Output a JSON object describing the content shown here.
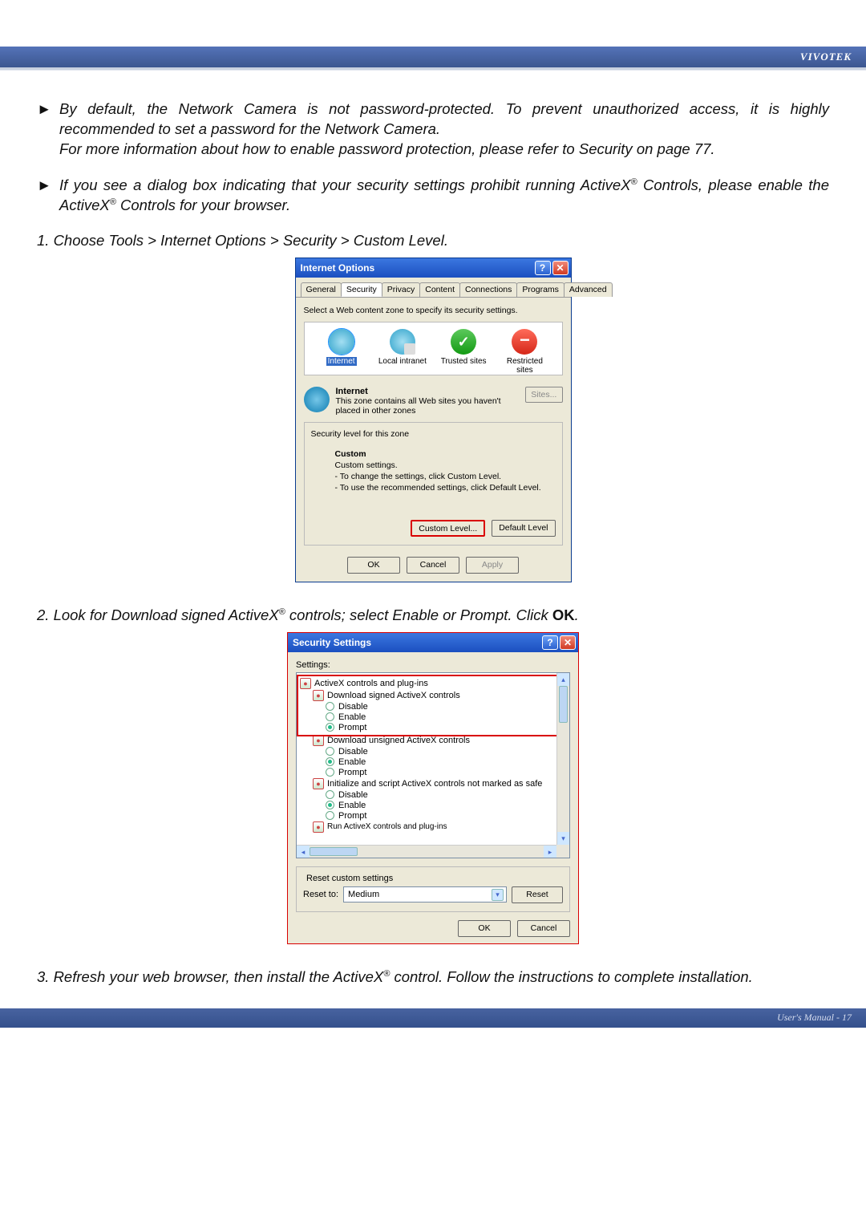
{
  "brand": "VIVOTEK",
  "bullets": {
    "b1_a": "By default, the Network Camera is not password-protected. To prevent unauthorized access, it is highly recommended to set a password for the Network Camera.",
    "b1_b": "For more information about how to enable password protection, please refer to Security on page 77.",
    "b2_a": "If you see a dialog box indicating that your security settings prohibit running ActiveX",
    "b2_b": " Controls, please enable the ActiveX",
    "b2_c": " Controls for your browser."
  },
  "steps": {
    "s1": "1. Choose Tools > Internet Options > Security > Custom Level.",
    "s2a": "2. Look for Download signed ActiveX",
    "s2b": " controls; select Enable or Prompt. Click ",
    "s2c": "OK",
    "s2d": ".",
    "s3a": "3. Refresh your web browser, then install the ActiveX",
    "s3b": " control. Follow the instructions to complete installation."
  },
  "reg": "®",
  "io": {
    "title": "Internet Options",
    "tabs": [
      "General",
      "Security",
      "Privacy",
      "Content",
      "Connections",
      "Programs",
      "Advanced"
    ],
    "instr": "Select a Web content zone to specify its security settings.",
    "zones": {
      "internet": "Internet",
      "local": "Local intranet",
      "trusted": "Trusted sites",
      "restricted": "Restricted",
      "restricted2": "sites"
    },
    "zone_desc_title": "Internet",
    "zone_desc_text": "This zone contains all Web sites you haven't placed in other zones",
    "sites": "Sites...",
    "sec_level_title": "Security level for this zone",
    "custom_title": "Custom",
    "custom_l1": "Custom settings.",
    "custom_l2": "- To change the settings, click Custom Level.",
    "custom_l3": "- To use the recommended settings, click Default Level.",
    "btn_custom": "Custom Level...",
    "btn_default": "Default Level",
    "ok": "OK",
    "cancel": "Cancel",
    "apply": "Apply"
  },
  "ss": {
    "title": "Security Settings",
    "settings_label": "Settings:",
    "cat1": "ActiveX controls and plug-ins",
    "n1": "Download signed ActiveX controls",
    "n2": "Download unsigned ActiveX controls",
    "n3": "Initialize and script ActiveX controls not marked as safe",
    "overflow": "Run ActiveX controls and plug-ins",
    "opt_disable": "Disable",
    "opt_enable": "Enable",
    "opt_prompt": "Prompt",
    "reset_title": "Reset custom settings",
    "reset_to": "Reset to:",
    "reset_value": "Medium",
    "reset_btn": "Reset",
    "ok": "OK",
    "cancel": "Cancel"
  },
  "footer": "User's Manual - 17"
}
